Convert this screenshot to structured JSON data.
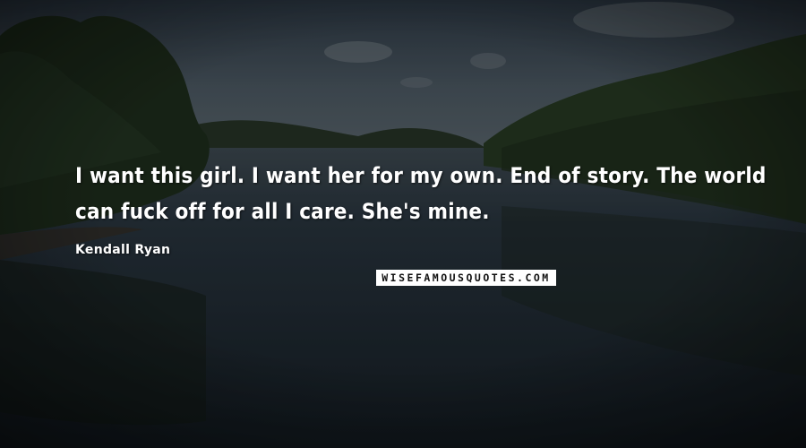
{
  "quote": {
    "text": "I want this girl. I want her for my own. End of story. The world can fuck off for all I care. She's mine.",
    "author": "Kendall Ryan"
  },
  "watermark": {
    "text": "WISEFAMOUSQUOTES.COM"
  },
  "colors": {
    "text": "#ffffff",
    "sky": "#3c4a55",
    "water": "#1c252c",
    "hills": "#1e2b1c"
  }
}
